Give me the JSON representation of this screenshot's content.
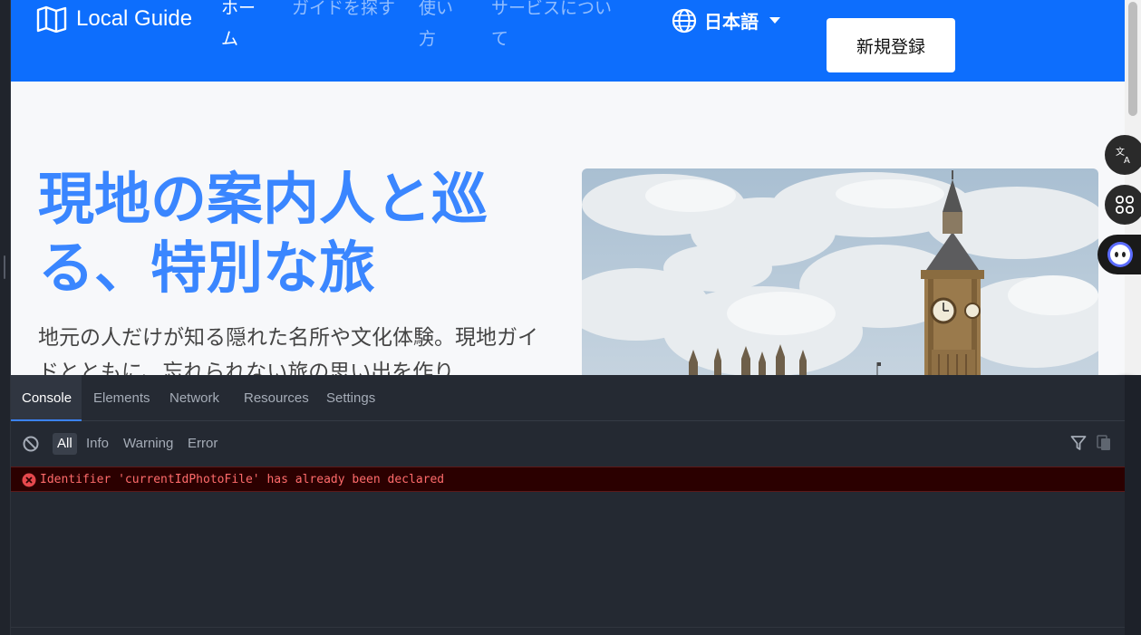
{
  "navbar": {
    "brand": "Local Guide",
    "links": [
      {
        "label": "ホーム",
        "active": true
      },
      {
        "label": "ガイドを探す",
        "active": false
      },
      {
        "label": "使い方",
        "active": false
      },
      {
        "label": "サービスについて",
        "active": false
      }
    ],
    "language": "日本語",
    "signup_label": "新規登録",
    "color": "#0d6efd"
  },
  "hero": {
    "title": "現地の案内人と巡る、特別な旅",
    "text": "地元の人だけが知る隠れた名所や文化体験。現地ガイドとともに、忘れられない旅の思い出を作り",
    "title_color": "#3a86ff",
    "image": "big-ben-photo"
  },
  "devtools": {
    "tabs": [
      {
        "label": "Console",
        "active": true
      },
      {
        "label": "Elements",
        "active": false
      },
      {
        "label": "Network",
        "active": false
      },
      {
        "label": "Resources",
        "active": false
      },
      {
        "label": "Settings",
        "active": false
      }
    ],
    "filters": [
      {
        "label": "All",
        "active": true
      },
      {
        "label": "Info",
        "active": false
      },
      {
        "label": "Warning",
        "active": false
      },
      {
        "label": "Error",
        "active": false
      }
    ],
    "messages": [
      {
        "level": "error",
        "text": "Identifier 'currentIdPhotoFile' has already been declared"
      }
    ],
    "error_color": "#ff6b6b"
  }
}
